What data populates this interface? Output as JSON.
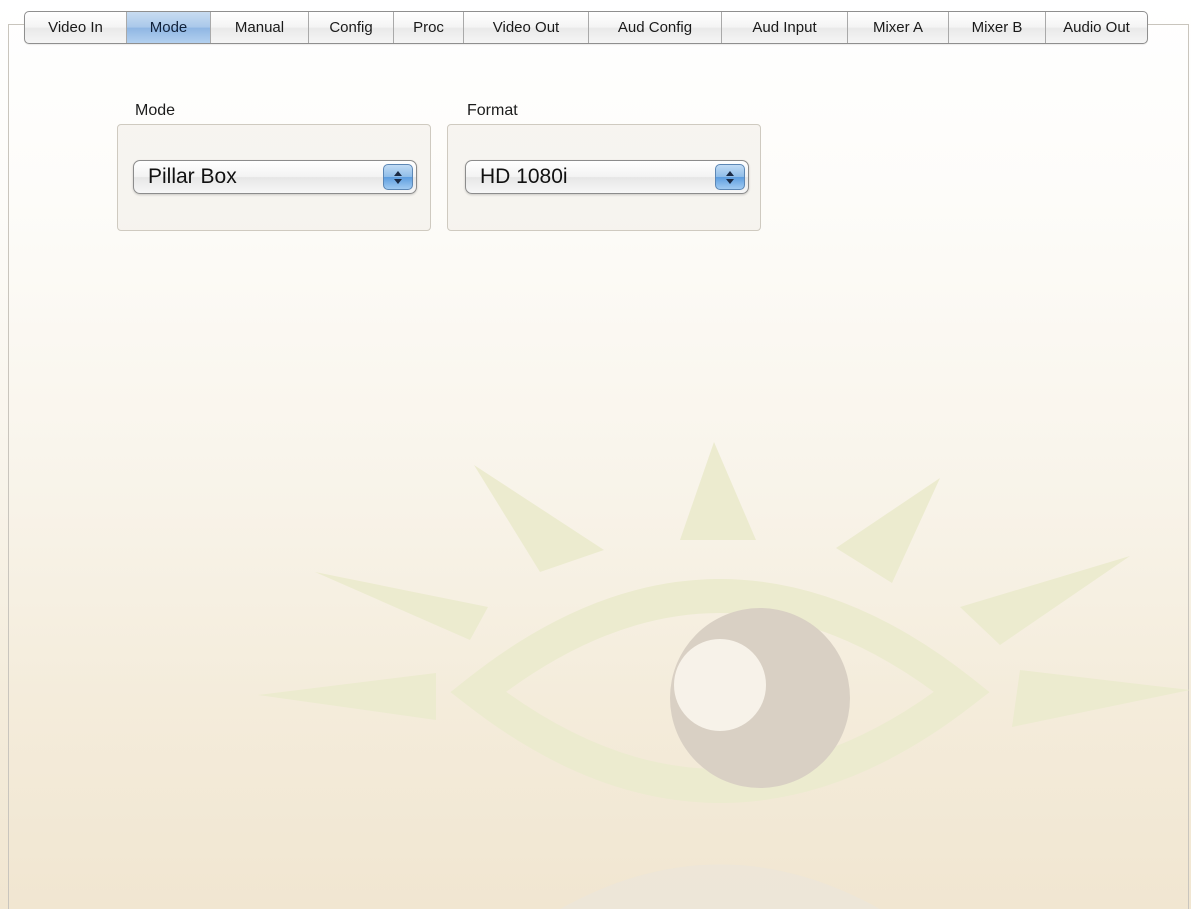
{
  "tabs": [
    {
      "label": "Video In"
    },
    {
      "label": "Mode"
    },
    {
      "label": "Manual"
    },
    {
      "label": "Config"
    },
    {
      "label": "Proc"
    },
    {
      "label": "Video Out"
    },
    {
      "label": "Aud Config"
    },
    {
      "label": "Aud Input"
    },
    {
      "label": "Mixer A"
    },
    {
      "label": "Mixer B"
    },
    {
      "label": "Audio Out"
    }
  ],
  "active_tab": "Mode",
  "mode_group": {
    "label": "Mode",
    "selected": "Pillar Box"
  },
  "format_group": {
    "label": "Format",
    "selected": "HD 1080i"
  },
  "colors": {
    "accent": "#8fb6e3",
    "watermark_green": "#ecebcf",
    "watermark_pupil": "#d9d0c4"
  },
  "icons": {
    "background": "eye-logo-watermark-icon",
    "popup_arrows": "up-down-stepper-icon"
  }
}
